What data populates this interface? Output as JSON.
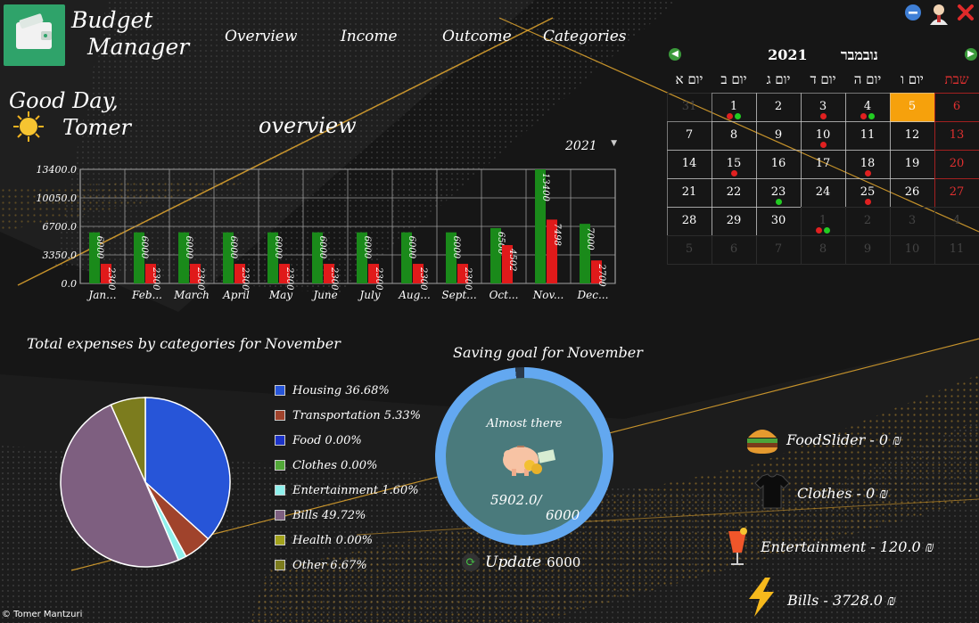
{
  "app": {
    "title_line1": "Budget",
    "title_line2": "Manager"
  },
  "nav": [
    "Overview",
    "Income",
    "Outcome",
    "Categories"
  ],
  "greeting": {
    "line1": "Good Day,",
    "name": "Tomer"
  },
  "section_title": "overview",
  "year_selector": {
    "value": "2021"
  },
  "chart_data": {
    "type": "bar",
    "categories": [
      "Jan...",
      "Feb...",
      "March",
      "April",
      "May",
      "June",
      "July",
      "Aug...",
      "Sept...",
      "Oct...",
      "Nov...",
      "Dec..."
    ],
    "series": [
      {
        "name": "",
        "color": "#1a8a1a",
        "values": [
          6000,
          6000,
          6000,
          6000,
          6000,
          6000,
          6000,
          6000,
          6000,
          6500,
          13400,
          7000
        ]
      },
      {
        "name": "",
        "color": "#e01a1a",
        "values": [
          2300,
          2300,
          2300,
          2300,
          2300,
          2300,
          2300,
          2300,
          2300,
          4502,
          7498,
          2700
        ]
      }
    ],
    "data_labels": [
      [
        "6000",
        "6000",
        "6000",
        "6000",
        "6000",
        "6000",
        "6000",
        "6000",
        "6000",
        "6500",
        "13400",
        "7000"
      ],
      [
        "2300",
        "2300",
        "2300",
        "2300",
        "2300",
        "2300",
        "2300",
        "2300",
        "2300",
        "4502",
        "7498",
        "2700"
      ]
    ],
    "y_ticks": [
      "0.0",
      "3350.0",
      "6700.0",
      "10050.0",
      "13400.0"
    ],
    "ylim": [
      0,
      13400
    ],
    "grid": true
  },
  "calendar": {
    "month": "נובמבר",
    "year": "2021",
    "weekdays": [
      "יום א",
      "יום ב",
      "יום ג",
      "יום ד",
      "יום ה",
      "יום ו",
      "שבת"
    ],
    "days": [
      {
        "d": "31",
        "dim": true
      },
      {
        "d": "1",
        "dots": [
          "#e02020",
          "#22cc22"
        ]
      },
      {
        "d": "2"
      },
      {
        "d": "3",
        "dots": [
          "#e02020"
        ]
      },
      {
        "d": "4",
        "dots": [
          "#e02020",
          "#22cc22"
        ]
      },
      {
        "d": "5",
        "today": true
      },
      {
        "d": "6",
        "sat": true
      },
      {
        "d": "7"
      },
      {
        "d": "8"
      },
      {
        "d": "9"
      },
      {
        "d": "10",
        "dots": [
          "#e02020"
        ]
      },
      {
        "d": "11"
      },
      {
        "d": "12"
      },
      {
        "d": "13",
        "sat": true
      },
      {
        "d": "14"
      },
      {
        "d": "15",
        "dots": [
          "#e02020"
        ]
      },
      {
        "d": "16"
      },
      {
        "d": "17"
      },
      {
        "d": "18",
        "dots": [
          "#e02020"
        ]
      },
      {
        "d": "19"
      },
      {
        "d": "20",
        "sat": true
      },
      {
        "d": "21"
      },
      {
        "d": "22"
      },
      {
        "d": "23",
        "dots": [
          "#22cc22"
        ]
      },
      {
        "d": "24"
      },
      {
        "d": "25",
        "dots": [
          "#e02020"
        ]
      },
      {
        "d": "26"
      },
      {
        "d": "27",
        "sat": true
      },
      {
        "d": "28"
      },
      {
        "d": "29"
      },
      {
        "d": "30"
      },
      {
        "d": "1",
        "dim": true,
        "dots": [
          "#e02020",
          "#22cc22"
        ]
      },
      {
        "d": "2",
        "dim": true
      },
      {
        "d": "3",
        "dim": true
      },
      {
        "d": "4",
        "dim": true
      },
      {
        "d": "5",
        "dim": true
      },
      {
        "d": "6",
        "dim": true
      },
      {
        "d": "7",
        "dim": true
      },
      {
        "d": "8",
        "dim": true
      },
      {
        "d": "9",
        "dim": true
      },
      {
        "d": "10",
        "dim": true
      },
      {
        "d": "11",
        "dim": true
      }
    ]
  },
  "pie": {
    "title": "Total expenses by categories for November",
    "slices": [
      {
        "label": "Housing 36.68%",
        "pct": 36.68,
        "color": "#2755d8"
      },
      {
        "label": "Transportation 5.33%",
        "pct": 5.33,
        "color": "#a0432c"
      },
      {
        "label": "Food 0.00%",
        "pct": 0.0,
        "color": "#1c33c8"
      },
      {
        "label": "Clothes 0.00%",
        "pct": 0.0,
        "color": "#52a838"
      },
      {
        "label": "Entertainment 1.60%",
        "pct": 1.6,
        "color": "#8ff0ec"
      },
      {
        "label": "Bills 49.72%",
        "pct": 49.72,
        "color": "#7e5f80"
      },
      {
        "label": "Health 0.00%",
        "pct": 0.0,
        "color": "#a3a31c"
      },
      {
        "label": "Other 6.67%",
        "pct": 6.67,
        "color": "#7c7c1e"
      }
    ]
  },
  "goal": {
    "title": "Saving goal for November",
    "message": "Almost there",
    "current": "5902.0/",
    "target": "6000",
    "progress": 0.9837,
    "update_label": "Update",
    "update_value": "6000"
  },
  "categories": [
    {
      "label": "FoodSlider - 0 ₪",
      "icon": "burger-icon"
    },
    {
      "label": "Clothes - 0 ₪",
      "icon": "shirt-icon"
    },
    {
      "label": "Entertainment - 120.0 ₪",
      "icon": "cocktail-icon"
    },
    {
      "label": "Bills - 3728.0 ₪",
      "icon": "lightning-icon"
    }
  ],
  "footer": "© Tomer Mantzuri"
}
